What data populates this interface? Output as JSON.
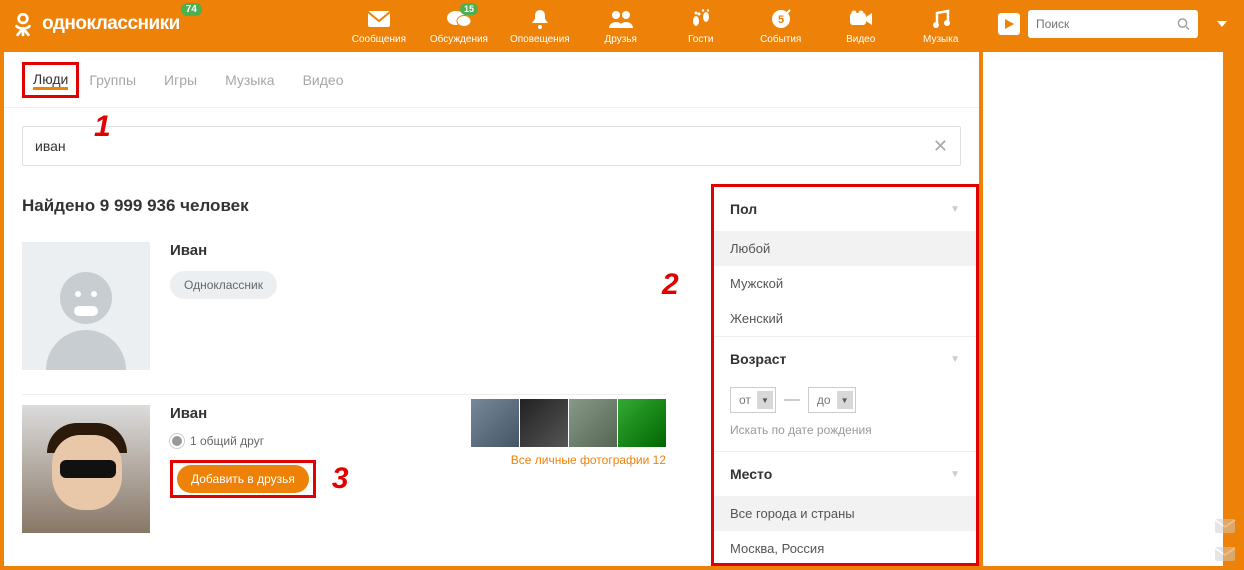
{
  "header": {
    "logo_text": "одноклассники",
    "logo_badge": "74",
    "nav": [
      {
        "label": "Сообщения",
        "icon": "mail"
      },
      {
        "label": "Обсуждения",
        "icon": "chat",
        "badge": "15"
      },
      {
        "label": "Оповещения",
        "icon": "bell"
      },
      {
        "label": "Друзья",
        "icon": "friends"
      },
      {
        "label": "Гости",
        "icon": "guests"
      },
      {
        "label": "События",
        "icon": "events"
      },
      {
        "label": "Видео",
        "icon": "video"
      },
      {
        "label": "Музыка",
        "icon": "music"
      }
    ],
    "search_placeholder": "Поиск"
  },
  "tabs": [
    "Люди",
    "Группы",
    "Игры",
    "Музыка",
    "Видео"
  ],
  "active_tab": "Люди",
  "search_value": "иван",
  "found_text": "Найдено 9 999 936 человек",
  "annotations": {
    "a1": "1",
    "a2": "2",
    "a3": "3"
  },
  "results": [
    {
      "name": "Иван",
      "tag": "Одноклассник"
    },
    {
      "name": "Иван",
      "mutual": "1 общий друг",
      "add_label": "Добавить в друзья",
      "photos_link": "Все личные фотографии 12"
    }
  ],
  "filters": {
    "gender": {
      "title": "Пол",
      "opts": [
        "Любой",
        "Мужской",
        "Женский"
      ],
      "selected": "Любой"
    },
    "age": {
      "title": "Возраст",
      "from": "от",
      "to": "до",
      "birth_link": "Искать по дате рождения"
    },
    "place": {
      "title": "Место",
      "opts": [
        "Все города и страны",
        "Москва, Россия"
      ],
      "selected": "Все города и страны"
    }
  }
}
